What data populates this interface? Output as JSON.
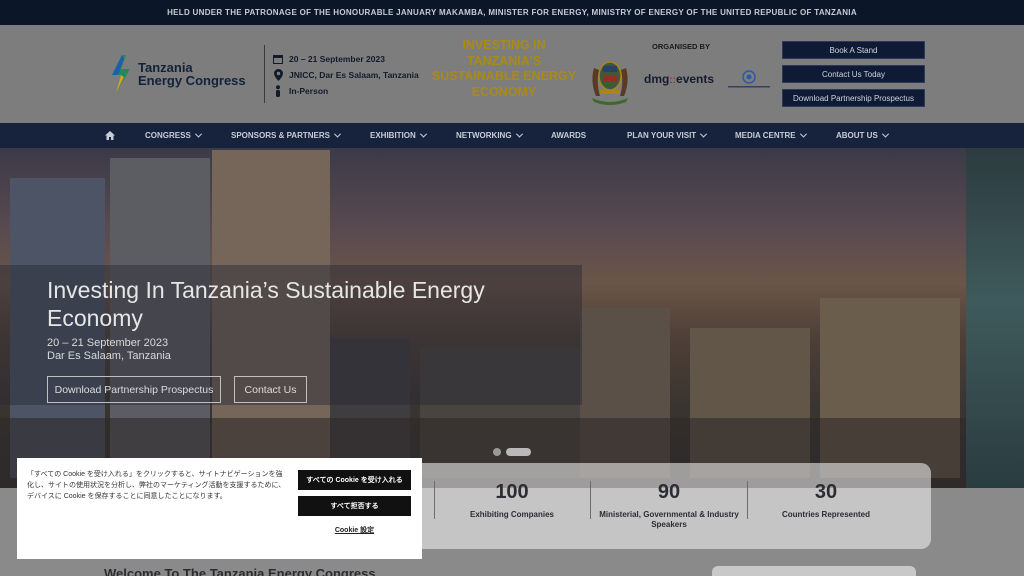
{
  "top_banner": "HELD UNDER THE PATRONAGE OF THE HONOURABLE JANUARY MAKAMBA, MINISTER FOR ENERGY, MINISTRY OF ENERGY OF THE UNITED REPUBLIC OF TANZANIA",
  "logo": {
    "line1": "Tanzania",
    "line2": "Energy Congress"
  },
  "event_info": {
    "date": "20 – 21 September 2023",
    "venue": "JNICC, Dar Es Salaam, Tanzania",
    "format": "In-Person"
  },
  "theme_title": "INVESTING IN TANZANIA'S SUSTAINABLE ENERGY ECONOMY",
  "organised_by": "ORGANISED BY",
  "organiser": {
    "name_a": "dmg",
    "name_sep": "::",
    "name_b": "events"
  },
  "header_buttons": [
    "Book A Stand",
    "Contact Us Today",
    "Download Partnership Prospectus"
  ],
  "nav": {
    "items": [
      {
        "label": "CONGRESS",
        "dropdown": true
      },
      {
        "label": "SPONSORS & PARTNERS",
        "dropdown": true
      },
      {
        "label": "EXHIBITION",
        "dropdown": true
      },
      {
        "label": "NETWORKING",
        "dropdown": true
      },
      {
        "label": "AWARDS",
        "dropdown": false
      },
      {
        "label": "PLAN YOUR VISIT",
        "dropdown": true
      },
      {
        "label": "MEDIA CENTRE",
        "dropdown": true
      },
      {
        "label": "ABOUT US",
        "dropdown": true
      }
    ]
  },
  "hero": {
    "title": "Investing In Tanzania’s Sustainable Energy Economy",
    "date": "20 – 21 September 2023",
    "location": "Dar Es Salaam, Tanzania",
    "primary_button": "Download Partnership Prospectus",
    "secondary_button": "Contact Us"
  },
  "stats": [
    {
      "value": "100",
      "label": "Exhibiting Companies"
    },
    {
      "value": "90",
      "label": "Ministerial, Governmental & Industry Speakers"
    },
    {
      "value": "30",
      "label": "Countries Represented"
    }
  ],
  "welcome_heading": "Welcome To The Tanzania Energy Congress",
  "cookie": {
    "text": "「すべての Cookie を受け入れる」をクリックすると、サイトナビゲーションを強化し、サイトの使用状況を分析し、弊社のマーケティング活動を支援するために、デバイスに Cookie を保存することに同意したことになります。",
    "accept_all": "すべての Cookie を受け入れる",
    "reject_all": "すべて拒否する",
    "settings": "Cookie 設定"
  },
  "colors": {
    "navy": "#17233d",
    "gold": "#a98a16",
    "accent_red": "#b3252c"
  }
}
